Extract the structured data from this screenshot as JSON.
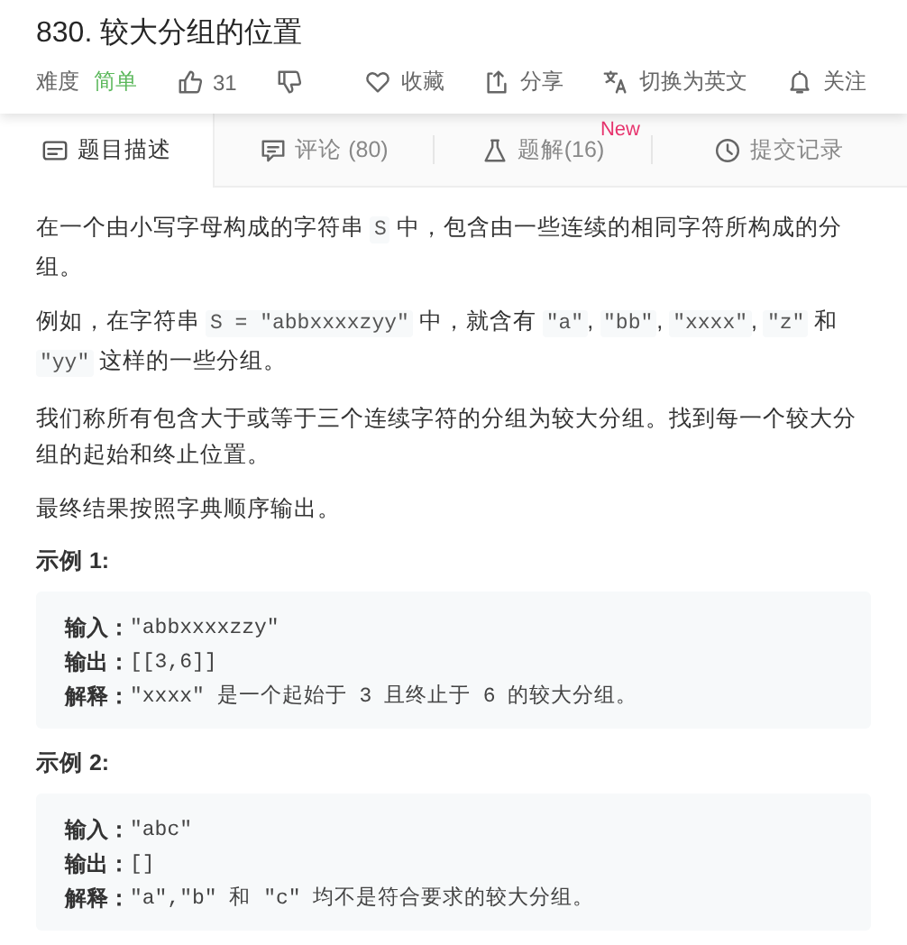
{
  "title": "830. 较大分组的位置",
  "meta": {
    "difficulty_label": "难度",
    "difficulty": "简单",
    "actions": [
      {
        "kind": "like",
        "label": "31"
      },
      {
        "kind": "dislike"
      },
      {
        "kind": "favorite",
        "label": "收藏"
      },
      {
        "kind": "share",
        "label": "分享"
      },
      {
        "kind": "translate",
        "label": "切换为英文"
      },
      {
        "kind": "follow",
        "label": "关注"
      }
    ]
  },
  "tabs": [
    {
      "kind": "description",
      "label": "题目描述",
      "selected": true
    },
    {
      "kind": "comments",
      "label": "评论 (80)",
      "selected": false
    },
    {
      "kind": "solutions",
      "label": "题解(16)",
      "selected": false,
      "badge": "New"
    },
    {
      "kind": "submissions",
      "label": "提交记录",
      "selected": false
    }
  ],
  "content": [
    {
      "kind": "paragraph",
      "segments": [
        {
          "kind": "text",
          "text": "在一个由小写字母构成的字符串 "
        },
        {
          "kind": "code",
          "text": "S"
        },
        {
          "kind": "text",
          "text": " 中，包含由一些连续的相同字符所构成的分组。"
        }
      ]
    },
    {
      "kind": "paragraph",
      "segments": [
        {
          "kind": "text",
          "text": "例如，在字符串 "
        },
        {
          "kind": "code",
          "text": "S = \"abbxxxxzyy\""
        },
        {
          "kind": "text",
          "text": " 中，就含有 "
        },
        {
          "kind": "code",
          "text": "\"a\""
        },
        {
          "kind": "text",
          "text": ", "
        },
        {
          "kind": "code",
          "text": "\"bb\""
        },
        {
          "kind": "text",
          "text": ", "
        },
        {
          "kind": "code",
          "text": "\"xxxx\""
        },
        {
          "kind": "text",
          "text": ", "
        },
        {
          "kind": "code",
          "text": "\"z\""
        },
        {
          "kind": "text",
          "text": " 和 "
        },
        {
          "kind": "code",
          "text": "\"yy\""
        },
        {
          "kind": "text",
          "text": " 这样的一些分组。"
        }
      ]
    },
    {
      "kind": "paragraph",
      "segments": [
        {
          "kind": "text",
          "text": "我们称所有包含大于或等于三个连续字符的分组为较大分组。找到每一个较大分组的起始和终止位置。"
        }
      ]
    },
    {
      "kind": "paragraph",
      "segments": [
        {
          "kind": "text",
          "text": "最终结果按照字典顺序输出。"
        }
      ]
    },
    {
      "kind": "heading",
      "text": "示例 1:"
    },
    {
      "kind": "example",
      "lines": [
        {
          "label": "输入：",
          "value": "\"abbxxxxzzy\""
        },
        {
          "label": "输出：",
          "value": "[[3,6]]"
        },
        {
          "label": "解释：",
          "value": "\"xxxx\" 是一个起始于 3 且终止于 6 的较大分组。"
        }
      ]
    },
    {
      "kind": "heading",
      "text": "示例 2:"
    },
    {
      "kind": "example",
      "lines": [
        {
          "label": "输入：",
          "value": "\"abc\""
        },
        {
          "label": "输出：",
          "value": "[]"
        },
        {
          "label": "解释：",
          "value": "\"a\",\"b\" 和 \"c\" 均不是符合要求的较大分组。"
        }
      ]
    }
  ]
}
